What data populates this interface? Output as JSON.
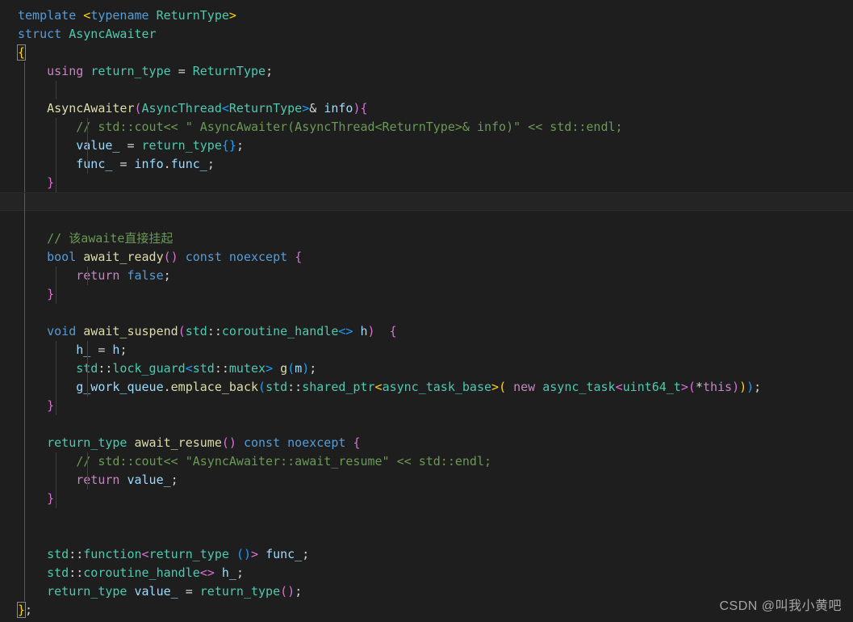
{
  "editor": {
    "language": "cpp",
    "theme": "Dark+ (default dark)",
    "background_color": "#1e1e1e",
    "active_line_color": "#242424",
    "font_size_px": 15,
    "line_height_px": 23,
    "active_line_index": 10,
    "colors": {
      "keyword": "#569cd6",
      "type": "#4ec9b0",
      "function": "#dcdcaa",
      "variable": "#9cdcfe",
      "comment": "#6a9955",
      "string": "#ce9178",
      "control": "#c586c0",
      "bracket1": "#ffd700",
      "bracket2": "#da70d6",
      "bracket3": "#179fff",
      "plain": "#d4d4d4"
    }
  },
  "watermark": {
    "text": "CSDN @叫我小黄吧"
  },
  "code": {
    "full_text": "template <typename ReturnType>\nstruct AsyncAwaiter\n{\n    using return_type = ReturnType;\n\n    AsyncAwaiter(AsyncThread<ReturnType>& info){\n        // std::cout<< \" AsyncAwaiter(AsyncThread<ReturnType>& info)\" << std::endl;\n        value_ = return_type{};\n        func_ = info.func_;\n    }\n\n\n    // 该awaite直接挂起\n    bool await_ready() const noexcept {\n        return false;\n    }\n\n    void await_suspend(std::coroutine_handle<> h)  {\n        h_ = h;\n        std::lock_guard<std::mutex> g(m);\n        g_work_queue.emplace_back(std::shared_ptr<async_task_base>( new async_task<uint64_t>(*this)));\n    }\n\n    return_type await_resume() const noexcept {\n        // std::cout<< \"AsyncAwaiter::await_resume\" << std::endl;\n        return value_;\n    }\n\n\n    std::function<return_type ()> func_;\n    std::coroutine_handle<> h_;\n    return_type value_ = return_type();\n};",
    "lines": [
      {
        "indent_guides": [],
        "tokens": [
          {
            "t": "template",
            "c": "t-kw"
          },
          {
            "t": " ",
            "c": "t-plain"
          },
          {
            "t": "<",
            "c": "t-p1"
          },
          {
            "t": "typename",
            "c": "t-kw"
          },
          {
            "t": " ",
            "c": "t-plain"
          },
          {
            "t": "ReturnType",
            "c": "t-type"
          },
          {
            "t": ">",
            "c": "t-p1"
          }
        ]
      },
      {
        "indent_guides": [],
        "tokens": [
          {
            "t": "struct",
            "c": "t-kw"
          },
          {
            "t": " ",
            "c": "t-plain"
          },
          {
            "t": "AsyncAwaiter",
            "c": "t-type"
          }
        ]
      },
      {
        "indent_guides": [],
        "tokens": [
          {
            "t": "{",
            "c": "t-p1 bracket-match"
          }
        ]
      },
      {
        "indent_guides": [
          0
        ],
        "tokens": [
          {
            "t": "    ",
            "c": "t-plain"
          },
          {
            "t": "using",
            "c": "t-ctl"
          },
          {
            "t": " ",
            "c": "t-plain"
          },
          {
            "t": "return_type",
            "c": "t-type"
          },
          {
            "t": " ",
            "c": "t-plain"
          },
          {
            "t": "=",
            "c": "t-op"
          },
          {
            "t": " ",
            "c": "t-plain"
          },
          {
            "t": "ReturnType",
            "c": "t-type"
          },
          {
            "t": ";",
            "c": "t-plain"
          }
        ]
      },
      {
        "indent_guides": [
          0,
          1
        ],
        "tokens": []
      },
      {
        "indent_guides": [
          0
        ],
        "tokens": [
          {
            "t": "    ",
            "c": "t-plain"
          },
          {
            "t": "AsyncAwaiter",
            "c": "t-fn"
          },
          {
            "t": "(",
            "c": "t-p2"
          },
          {
            "t": "AsyncThread",
            "c": "t-type"
          },
          {
            "t": "<",
            "c": "t-p3"
          },
          {
            "t": "ReturnType",
            "c": "t-type"
          },
          {
            "t": ">",
            "c": "t-p3"
          },
          {
            "t": "&",
            "c": "t-op"
          },
          {
            "t": " ",
            "c": "t-plain"
          },
          {
            "t": "info",
            "c": "t-var"
          },
          {
            "t": ")",
            "c": "t-p2"
          },
          {
            "t": "{",
            "c": "t-p2"
          }
        ]
      },
      {
        "indent_guides": [
          0,
          1,
          2
        ],
        "tokens": [
          {
            "t": "        ",
            "c": "t-plain"
          },
          {
            "t": "// std::cout<< \" AsyncAwaiter(AsyncThread<ReturnType>& info)\" << std::endl;",
            "c": "t-cmt"
          }
        ]
      },
      {
        "indent_guides": [
          0,
          1,
          2
        ],
        "tokens": [
          {
            "t": "        ",
            "c": "t-plain"
          },
          {
            "t": "value_",
            "c": "t-var"
          },
          {
            "t": " ",
            "c": "t-plain"
          },
          {
            "t": "=",
            "c": "t-op"
          },
          {
            "t": " ",
            "c": "t-plain"
          },
          {
            "t": "return_type",
            "c": "t-type"
          },
          {
            "t": "{",
            "c": "t-p3"
          },
          {
            "t": "}",
            "c": "t-p3"
          },
          {
            "t": ";",
            "c": "t-plain"
          }
        ]
      },
      {
        "indent_guides": [
          0,
          1,
          2
        ],
        "tokens": [
          {
            "t": "        ",
            "c": "t-plain"
          },
          {
            "t": "func_",
            "c": "t-var"
          },
          {
            "t": " ",
            "c": "t-plain"
          },
          {
            "t": "=",
            "c": "t-op"
          },
          {
            "t": " ",
            "c": "t-plain"
          },
          {
            "t": "info",
            "c": "t-var"
          },
          {
            "t": ".",
            "c": "t-plain"
          },
          {
            "t": "func_",
            "c": "t-var"
          },
          {
            "t": ";",
            "c": "t-plain"
          }
        ]
      },
      {
        "indent_guides": [
          0,
          1
        ],
        "tokens": [
          {
            "t": "    ",
            "c": "t-plain"
          },
          {
            "t": "}",
            "c": "t-p2"
          }
        ]
      },
      {
        "indent_guides": [
          0
        ],
        "tokens": []
      },
      {
        "indent_guides": [
          0
        ],
        "tokens": []
      },
      {
        "indent_guides": [
          0
        ],
        "tokens": [
          {
            "t": "    ",
            "c": "t-plain"
          },
          {
            "t": "// 该awaite直接挂起",
            "c": "t-cmt"
          }
        ]
      },
      {
        "indent_guides": [
          0
        ],
        "tokens": [
          {
            "t": "    ",
            "c": "t-plain"
          },
          {
            "t": "bool",
            "c": "t-kw"
          },
          {
            "t": " ",
            "c": "t-plain"
          },
          {
            "t": "await_ready",
            "c": "t-fn"
          },
          {
            "t": "(",
            "c": "t-p2"
          },
          {
            "t": ")",
            "c": "t-p2"
          },
          {
            "t": " ",
            "c": "t-plain"
          },
          {
            "t": "const",
            "c": "t-kw"
          },
          {
            "t": " ",
            "c": "t-plain"
          },
          {
            "t": "noexcept",
            "c": "t-kw"
          },
          {
            "t": " ",
            "c": "t-plain"
          },
          {
            "t": "{",
            "c": "t-p2"
          }
        ]
      },
      {
        "indent_guides": [
          0,
          1,
          2
        ],
        "tokens": [
          {
            "t": "        ",
            "c": "t-plain"
          },
          {
            "t": "return",
            "c": "t-ctl"
          },
          {
            "t": " ",
            "c": "t-plain"
          },
          {
            "t": "false",
            "c": "t-kw"
          },
          {
            "t": ";",
            "c": "t-plain"
          }
        ]
      },
      {
        "indent_guides": [
          0,
          1
        ],
        "tokens": [
          {
            "t": "    ",
            "c": "t-plain"
          },
          {
            "t": "}",
            "c": "t-p2"
          }
        ]
      },
      {
        "indent_guides": [
          0
        ],
        "tokens": []
      },
      {
        "indent_guides": [
          0
        ],
        "tokens": [
          {
            "t": "    ",
            "c": "t-plain"
          },
          {
            "t": "void",
            "c": "t-kw"
          },
          {
            "t": " ",
            "c": "t-plain"
          },
          {
            "t": "await_suspend",
            "c": "t-fn"
          },
          {
            "t": "(",
            "c": "t-p2"
          },
          {
            "t": "std",
            "c": "t-type"
          },
          {
            "t": "::",
            "c": "t-plain"
          },
          {
            "t": "coroutine_handle",
            "c": "t-type"
          },
          {
            "t": "<",
            "c": "t-p3"
          },
          {
            "t": ">",
            "c": "t-p3"
          },
          {
            "t": " ",
            "c": "t-plain"
          },
          {
            "t": "h",
            "c": "t-var"
          },
          {
            "t": ")",
            "c": "t-p2"
          },
          {
            "t": "  ",
            "c": "t-plain"
          },
          {
            "t": "{",
            "c": "t-p2"
          }
        ]
      },
      {
        "indent_guides": [
          0,
          1,
          2
        ],
        "tokens": [
          {
            "t": "        ",
            "c": "t-plain"
          },
          {
            "t": "h_",
            "c": "t-var"
          },
          {
            "t": " ",
            "c": "t-plain"
          },
          {
            "t": "=",
            "c": "t-op"
          },
          {
            "t": " ",
            "c": "t-plain"
          },
          {
            "t": "h",
            "c": "t-var"
          },
          {
            "t": ";",
            "c": "t-plain"
          }
        ]
      },
      {
        "indent_guides": [
          0,
          1,
          2
        ],
        "tokens": [
          {
            "t": "        ",
            "c": "t-plain"
          },
          {
            "t": "std",
            "c": "t-type"
          },
          {
            "t": "::",
            "c": "t-plain"
          },
          {
            "t": "lock_guard",
            "c": "t-type"
          },
          {
            "t": "<",
            "c": "t-p3"
          },
          {
            "t": "std",
            "c": "t-type"
          },
          {
            "t": "::",
            "c": "t-plain"
          },
          {
            "t": "mutex",
            "c": "t-type"
          },
          {
            "t": ">",
            "c": "t-p3"
          },
          {
            "t": " ",
            "c": "t-plain"
          },
          {
            "t": "g",
            "c": "t-fn"
          },
          {
            "t": "(",
            "c": "t-p3"
          },
          {
            "t": "m",
            "c": "t-var"
          },
          {
            "t": ")",
            "c": "t-p3"
          },
          {
            "t": ";",
            "c": "t-plain"
          }
        ]
      },
      {
        "indent_guides": [
          0,
          1,
          2
        ],
        "tokens": [
          {
            "t": "        ",
            "c": "t-plain"
          },
          {
            "t": "g_work_queue",
            "c": "t-var"
          },
          {
            "t": ".",
            "c": "t-plain"
          },
          {
            "t": "emplace_back",
            "c": "t-fn"
          },
          {
            "t": "(",
            "c": "t-p3"
          },
          {
            "t": "std",
            "c": "t-type"
          },
          {
            "t": "::",
            "c": "t-plain"
          },
          {
            "t": "shared_ptr",
            "c": "t-type"
          },
          {
            "t": "<",
            "c": "t-p1"
          },
          {
            "t": "async_task_base",
            "c": "t-type"
          },
          {
            "t": ">",
            "c": "t-p1"
          },
          {
            "t": "(",
            "c": "t-p1"
          },
          {
            "t": " ",
            "c": "t-plain"
          },
          {
            "t": "new",
            "c": "t-ctl"
          },
          {
            "t": " ",
            "c": "t-plain"
          },
          {
            "t": "async_task",
            "c": "t-type"
          },
          {
            "t": "<",
            "c": "t-p2"
          },
          {
            "t": "uint64_t",
            "c": "t-type"
          },
          {
            "t": ">",
            "c": "t-p2"
          },
          {
            "t": "(",
            "c": "t-p2"
          },
          {
            "t": "*",
            "c": "t-op"
          },
          {
            "t": "this",
            "c": "t-ctl"
          },
          {
            "t": ")",
            "c": "t-p2"
          },
          {
            "t": ")",
            "c": "t-p1"
          },
          {
            "t": ")",
            "c": "t-p3"
          },
          {
            "t": ";",
            "c": "t-plain"
          }
        ]
      },
      {
        "indent_guides": [
          0,
          1
        ],
        "tokens": [
          {
            "t": "    ",
            "c": "t-plain"
          },
          {
            "t": "}",
            "c": "t-p2"
          }
        ]
      },
      {
        "indent_guides": [
          0
        ],
        "tokens": []
      },
      {
        "indent_guides": [
          0
        ],
        "tokens": [
          {
            "t": "    ",
            "c": "t-plain"
          },
          {
            "t": "return_type",
            "c": "t-type"
          },
          {
            "t": " ",
            "c": "t-plain"
          },
          {
            "t": "await_resume",
            "c": "t-fn"
          },
          {
            "t": "(",
            "c": "t-p2"
          },
          {
            "t": ")",
            "c": "t-p2"
          },
          {
            "t": " ",
            "c": "t-plain"
          },
          {
            "t": "const",
            "c": "t-kw"
          },
          {
            "t": " ",
            "c": "t-plain"
          },
          {
            "t": "noexcept",
            "c": "t-kw"
          },
          {
            "t": " ",
            "c": "t-plain"
          },
          {
            "t": "{",
            "c": "t-p2"
          }
        ]
      },
      {
        "indent_guides": [
          0,
          1,
          2
        ],
        "tokens": [
          {
            "t": "        ",
            "c": "t-plain"
          },
          {
            "t": "// std::cout<< \"AsyncAwaiter::await_resume\" << std::endl;",
            "c": "t-cmt"
          }
        ]
      },
      {
        "indent_guides": [
          0,
          1,
          2
        ],
        "tokens": [
          {
            "t": "        ",
            "c": "t-plain"
          },
          {
            "t": "return",
            "c": "t-ctl"
          },
          {
            "t": " ",
            "c": "t-plain"
          },
          {
            "t": "value_",
            "c": "t-var"
          },
          {
            "t": ";",
            "c": "t-plain"
          }
        ]
      },
      {
        "indent_guides": [
          0,
          1
        ],
        "tokens": [
          {
            "t": "    ",
            "c": "t-plain"
          },
          {
            "t": "}",
            "c": "t-p2"
          }
        ]
      },
      {
        "indent_guides": [
          0
        ],
        "tokens": []
      },
      {
        "indent_guides": [
          0
        ],
        "tokens": []
      },
      {
        "indent_guides": [
          0
        ],
        "tokens": [
          {
            "t": "    ",
            "c": "t-plain"
          },
          {
            "t": "std",
            "c": "t-type"
          },
          {
            "t": "::",
            "c": "t-plain"
          },
          {
            "t": "function",
            "c": "t-type"
          },
          {
            "t": "<",
            "c": "t-p2"
          },
          {
            "t": "return_type",
            "c": "t-type"
          },
          {
            "t": " ",
            "c": "t-plain"
          },
          {
            "t": "(",
            "c": "t-p3"
          },
          {
            "t": ")",
            "c": "t-p3"
          },
          {
            "t": ">",
            "c": "t-p2"
          },
          {
            "t": " ",
            "c": "t-plain"
          },
          {
            "t": "func_",
            "c": "t-var"
          },
          {
            "t": ";",
            "c": "t-plain"
          }
        ]
      },
      {
        "indent_guides": [
          0
        ],
        "tokens": [
          {
            "t": "    ",
            "c": "t-plain"
          },
          {
            "t": "std",
            "c": "t-type"
          },
          {
            "t": "::",
            "c": "t-plain"
          },
          {
            "t": "coroutine_handle",
            "c": "t-type"
          },
          {
            "t": "<",
            "c": "t-p2"
          },
          {
            "t": ">",
            "c": "t-p2"
          },
          {
            "t": " ",
            "c": "t-plain"
          },
          {
            "t": "h_",
            "c": "t-var"
          },
          {
            "t": ";",
            "c": "t-plain"
          }
        ]
      },
      {
        "indent_guides": [
          0
        ],
        "tokens": [
          {
            "t": "    ",
            "c": "t-plain"
          },
          {
            "t": "return_type",
            "c": "t-type"
          },
          {
            "t": " ",
            "c": "t-plain"
          },
          {
            "t": "value_",
            "c": "t-var"
          },
          {
            "t": " ",
            "c": "t-plain"
          },
          {
            "t": "=",
            "c": "t-op"
          },
          {
            "t": " ",
            "c": "t-plain"
          },
          {
            "t": "return_type",
            "c": "t-type"
          },
          {
            "t": "(",
            "c": "t-p2"
          },
          {
            "t": ")",
            "c": "t-p2"
          },
          {
            "t": ";",
            "c": "t-plain"
          }
        ]
      },
      {
        "indent_guides": [],
        "tokens": [
          {
            "t": "}",
            "c": "t-p1 bracket-match"
          },
          {
            "t": ";",
            "c": "t-plain"
          }
        ]
      }
    ]
  }
}
